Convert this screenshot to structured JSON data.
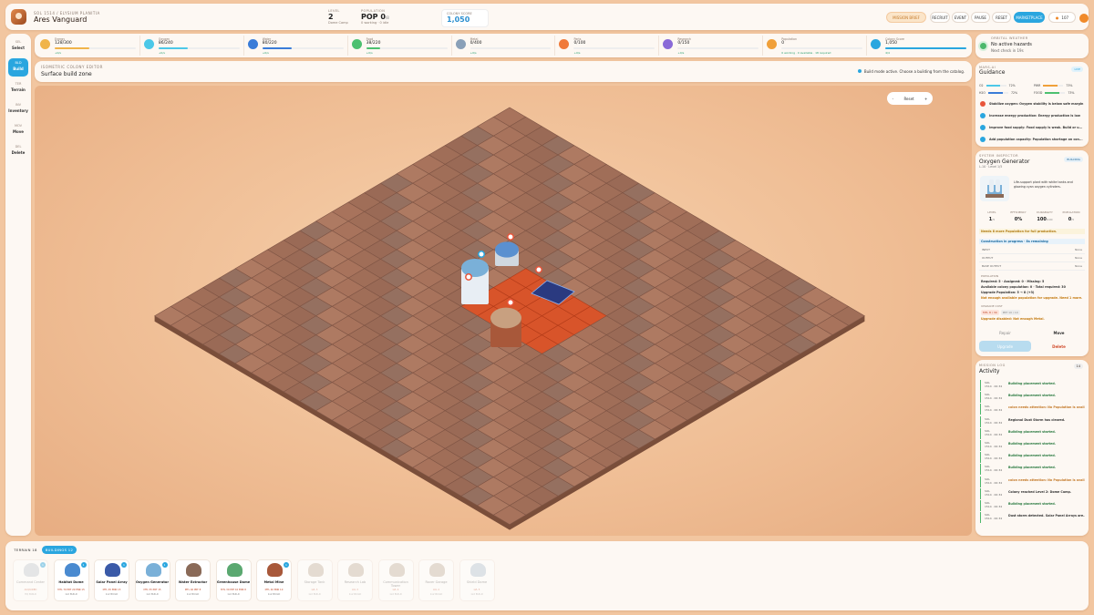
{
  "header": {
    "subtitle": "SOL 1514 / ELYSIUM PLANITIA",
    "colony_name": "Ares Vanguard",
    "level_label": "LEVEL",
    "level_value": "2",
    "level_note": "Dome Camp",
    "population_label": "POPULATION",
    "population_value": "POP 0",
    "population_max": "/8",
    "population_note": "0 working · 0 idle",
    "score_label": "COLONY SCORE",
    "score_value": "1,050",
    "mission_btn": "MISSION BRIEF",
    "recruit_btn": "RECRUIT",
    "event_btn": "EVENT",
    "pause_btn": "PAUSE",
    "reset_btn": "RESET",
    "marketplace_btn": "MARKETPLACE",
    "coins": "107"
  },
  "sidebar": {
    "items": [
      {
        "key": "SEL",
        "label": "Select"
      },
      {
        "key": "BLD",
        "label": "Build",
        "active": true
      },
      {
        "key": "TER",
        "label": "Terrain"
      },
      {
        "key": "INV",
        "label": "Inventory"
      },
      {
        "key": "MOV",
        "label": "Move"
      },
      {
        "key": "DEL",
        "label": "Delete"
      }
    ]
  },
  "resources": [
    {
      "icon": "energy-icon",
      "name": "Energy",
      "value": "128/300",
      "color": "#f0b44a",
      "fill": 0.43,
      "delta": "+0/s"
    },
    {
      "icon": "oxygen-icon",
      "name": "Oxygen",
      "value": "86/240",
      "color": "#4cc8e8",
      "fill": 0.36,
      "delta": "+0/s"
    },
    {
      "icon": "water-icon",
      "name": "Water",
      "value": "80/220",
      "color": "#3a7cd8",
      "fill": 0.36,
      "delta": "+0/s"
    },
    {
      "icon": "food-icon",
      "name": "Food",
      "value": "38/220",
      "color": "#4cc070",
      "fill": 0.17,
      "delta": "+0/s"
    },
    {
      "icon": "metal-icon",
      "name": "Metal",
      "value": "0/400",
      "color": "#8aa0b8",
      "fill": 0.0,
      "delta": "+0/s"
    },
    {
      "icon": "parts-icon",
      "name": "Parts",
      "value": "0/100",
      "color": "#f07a3a",
      "fill": 0.0,
      "delta": "+0/s"
    },
    {
      "icon": "research-icon",
      "name": "Research",
      "value": "0/150",
      "color": "#8a6ad8",
      "fill": 0.0,
      "delta": "+0/s"
    },
    {
      "icon": "population-icon",
      "name": "Population",
      "value": "0",
      "color": "#f0a03a",
      "fill": 0.0,
      "delta": "0 working · 0 available · 18 required"
    },
    {
      "icon": "score-icon",
      "name": "Colony Score",
      "value": "1,050",
      "color": "#2aa6df",
      "fill": 1.0,
      "delta": "4/4"
    }
  ],
  "editor": {
    "kicker": "ISOMETRIC COLONY EDITOR",
    "title": "Surface build zone",
    "hint": "Build mode active. Choose a building from the catalog.",
    "zoom_minus": "-",
    "zoom_reset": "Reset",
    "zoom_plus": "+"
  },
  "weather": {
    "kicker": "ORBITAL WEATHER",
    "status": "No active hazards",
    "next": "Next check in 19s"
  },
  "guidance": {
    "kicker": "MARS-AI",
    "title": "Guidance",
    "live": "LIVE",
    "stats": [
      {
        "k": "O2",
        "v": "72%",
        "color": "#4cc8e8",
        "fill": 0.72
      },
      {
        "k": "PWR",
        "v": "73%",
        "color": "#f0a03a",
        "fill": 0.73
      },
      {
        "k": "H2O",
        "v": "72%",
        "color": "#3a7cd8",
        "fill": 0.72
      },
      {
        "k": "FOOD",
        "v": "73%",
        "color": "#4cc070",
        "fill": 0.73
      }
    ],
    "items": [
      {
        "icon": "warning-icon",
        "text": "Stabilize oxygen: Oxygen stability is below safe margin",
        "color": "#e8553a"
      },
      {
        "icon": "energy-icon",
        "text": "Increase energy production: Energy production is low",
        "color": "#2aa6df"
      },
      {
        "icon": "food-icon",
        "text": "Improve food supply: Food supply is weak. Build or u...",
        "color": "#2aa6df"
      },
      {
        "icon": "population-icon",
        "text": "Add population capacity: Population shortage on con...",
        "color": "#2aa6df"
      }
    ]
  },
  "inspector": {
    "kicker": "SYSTEM INSPECTOR",
    "title": "Oxygen Generator",
    "sub": "L-10 · Level 1/5",
    "badge": "BUILDING",
    "desc": "Life-support plant with white tanks and glowing cyan oxygen cylinders.",
    "level_k": "LEVEL",
    "level_v": "1",
    "level_max": "/5",
    "eff_k": "EFFICIENCY",
    "eff_v": "0%",
    "dur_k": "DURABILITY",
    "dur_v": "100",
    "dur_max": "/100",
    "pop_k": "POPULATION",
    "pop_v": "0",
    "pop_max": "/5",
    "warn1": "Needs 8 more Population for full production.",
    "warn2": "Construction in progress · 8s remaining",
    "input_k": "INPUT",
    "input_v": "None",
    "output_k": "OUTPUT",
    "output_v": "None",
    "base_k": "BASE OUTPUT",
    "base_v": "None",
    "pop_section": "POPULATION",
    "pop_l1": "Required: 5 · Assigned: 0 · Missing: 5",
    "pop_l2": "Available colony population: 0 · Total required: 30",
    "pop_l3": "Upgrade Population: 5 → 8 (+3)",
    "pop_l4": "Not enough available population for upgrade. Need 1 more.",
    "upgrade_cost_k": "UPGRADE COST",
    "cost1": "MTL 8 / 30",
    "cost2": "PRT 10 / 10",
    "upgrade_warn": "Upgrade disabled: Not enough Metal.",
    "repair_btn": "Repair",
    "move_btn": "Move",
    "upgrade_btn": "Upgrade",
    "delete_btn": "Delete"
  },
  "activity": {
    "kicker": "MISSION LOG",
    "title": "Activity",
    "count": "14",
    "logs": [
      {
        "sol": "SOL",
        "time": "1514 · 00:34",
        "msg": "Building placement started.",
        "color": "#2a7a40"
      },
      {
        "sol": "SOL",
        "time": "1514 · 00:34",
        "msg": "Building placement started.",
        "color": "#2a7a40"
      },
      {
        "sol": "SOL",
        "time": "1514 · 00:34",
        "msg": "colon needs attention: No Population is avail...",
        "color": "#c47a2a"
      },
      {
        "sol": "SOL",
        "time": "1514 · 00:34",
        "msg": "Regional Dust Storm has cleared.",
        "color": "#333"
      },
      {
        "sol": "SOL",
        "time": "1514 · 00:34",
        "msg": "Building placement started.",
        "color": "#2a7a40"
      },
      {
        "sol": "SOL",
        "time": "1514 · 00:34",
        "msg": "Building placement started.",
        "color": "#2a7a40"
      },
      {
        "sol": "SOL",
        "time": "1514 · 00:34",
        "msg": "Building placement started.",
        "color": "#2a7a40"
      },
      {
        "sol": "SOL",
        "time": "1514 · 00:34",
        "msg": "Building placement started.",
        "color": "#2a7a40"
      },
      {
        "sol": "SOL",
        "time": "1514 · 00:34",
        "msg": "colon needs attention: No Population is avail...",
        "color": "#c47a2a"
      },
      {
        "sol": "SOL",
        "time": "1514 · 00:34",
        "msg": "Colony reached Level 2: Dome Camp.",
        "color": "#333"
      },
      {
        "sol": "SOL",
        "time": "1514 · 00:34",
        "msg": "Building placement started.",
        "color": "#2a7a40"
      },
      {
        "sol": "SOL",
        "time": "1514 · 00:34",
        "msg": "Dust storm detected. Solar Panel Arrays are...",
        "color": "#333"
      }
    ]
  },
  "catalog": {
    "tab_terrain": "TERRAIN 18",
    "tab_buildings": "BUILDINGS 12",
    "cards": [
      {
        "name": "Command Center",
        "cost": "ACQUIRED",
        "tier": "HQ BUILD",
        "count": "1",
        "locked": true,
        "color": "#c8d0d8"
      },
      {
        "name": "Habitat Dome",
        "cost": "MTL 70 PRT 20 ENR 15",
        "tier": "1x2 BUILD",
        "count": "1",
        "locked": false,
        "color": "#4a8ad0"
      },
      {
        "name": "Solar Panel Array",
        "cost": "MTL 45 ENR 15",
        "tier": "1x2 BUILD",
        "count": "1",
        "locked": false,
        "color": "#3a5aa8"
      },
      {
        "name": "Oxygen Generator",
        "cost": "MTL 55 PRT 15",
        "tier": "1x2 BUILD",
        "count": "1",
        "locked": false,
        "color": "#7ab0d8"
      },
      {
        "name": "Water Extractor",
        "cost": "MTL 40 PRT 8",
        "tier": "1x2 BUILD",
        "count": "",
        "locked": false,
        "color": "#8a6a58"
      },
      {
        "name": "Greenhouse Dome",
        "cost": "MTL 30 PRT 10 ENR 8",
        "tier": "1x2 BUILD",
        "count": "",
        "locked": false,
        "color": "#5aa870"
      },
      {
        "name": "Metal Mine",
        "cost": "MTL 40 ENR 10",
        "tier": "1x2 BUILD",
        "count": "1",
        "locked": false,
        "color": "#a8583a"
      },
      {
        "name": "Storage Tank",
        "cost": "LVL 3",
        "tier": "1x2 BUILD",
        "count": "",
        "locked": true,
        "color": "#c8b8a8"
      },
      {
        "name": "Research Lab",
        "cost": "LVL 3",
        "tier": "1x2 BUILD",
        "count": "",
        "locked": true,
        "color": "#c8b8a8"
      },
      {
        "name": "Communication Tower",
        "cost": "LVL 4",
        "tier": "1x2 BUILD",
        "count": "",
        "locked": true,
        "color": "#c8b8a8"
      },
      {
        "name": "Rover Garage",
        "cost": "LVL 4",
        "tier": "1x2 BUILD",
        "count": "",
        "locked": true,
        "color": "#c8b8a8"
      },
      {
        "name": "Shield Dome",
        "cost": "LVL 5",
        "tier": "1x2 BUILD",
        "count": "",
        "locked": true,
        "color": "#b8c8d8"
      }
    ]
  }
}
